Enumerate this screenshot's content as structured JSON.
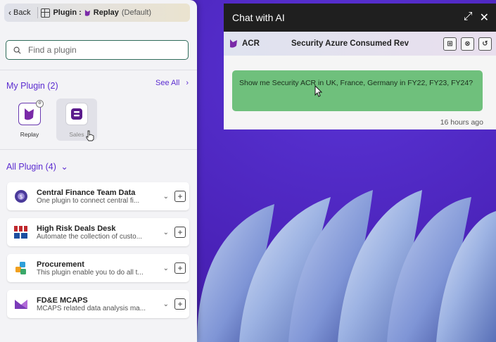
{
  "topbar": {
    "back_label": "Back",
    "plugin_label": "Plugin :",
    "current_plugin": "Replay",
    "current_suffix": "(Default)"
  },
  "search": {
    "placeholder": "Find a plugin"
  },
  "my_plugins": {
    "title": "My Plugin (2)",
    "see_all": "See All",
    "items": [
      {
        "label": "Replay",
        "color": "#7a2aa8"
      },
      {
        "label": "Sales",
        "color": "#5a1a8c"
      }
    ]
  },
  "all_plugins": {
    "title": "All Plugin (4)",
    "items": [
      {
        "title": "Central Finance Team Data",
        "description": "One plugin to connect central fi...",
        "icon": "finance-icon"
      },
      {
        "title": "High Risk Deals Desk",
        "description": "Automate the collection of custo...",
        "icon": "risk-icon"
      },
      {
        "title": "Procurement",
        "description": "This plugin enable you to do all t...",
        "icon": "procurement-icon"
      },
      {
        "title": "FD&E MCAPS",
        "description": "MCAPS related data analysis ma...",
        "icon": "mcaps-icon"
      }
    ]
  },
  "chat": {
    "title": "Chat with AI",
    "context_tag": "ACR",
    "context_title": "Security Azure Consumed Rev",
    "message": "Show me Security ACR in UK, France, Germany in FY22, FY23, FY24?",
    "timestamp": "16 hours ago"
  },
  "colors": {
    "accent": "#5b2bd0",
    "bubble": "#6fc07c",
    "header": "#1f1f1f",
    "background": "#4a22b8"
  }
}
